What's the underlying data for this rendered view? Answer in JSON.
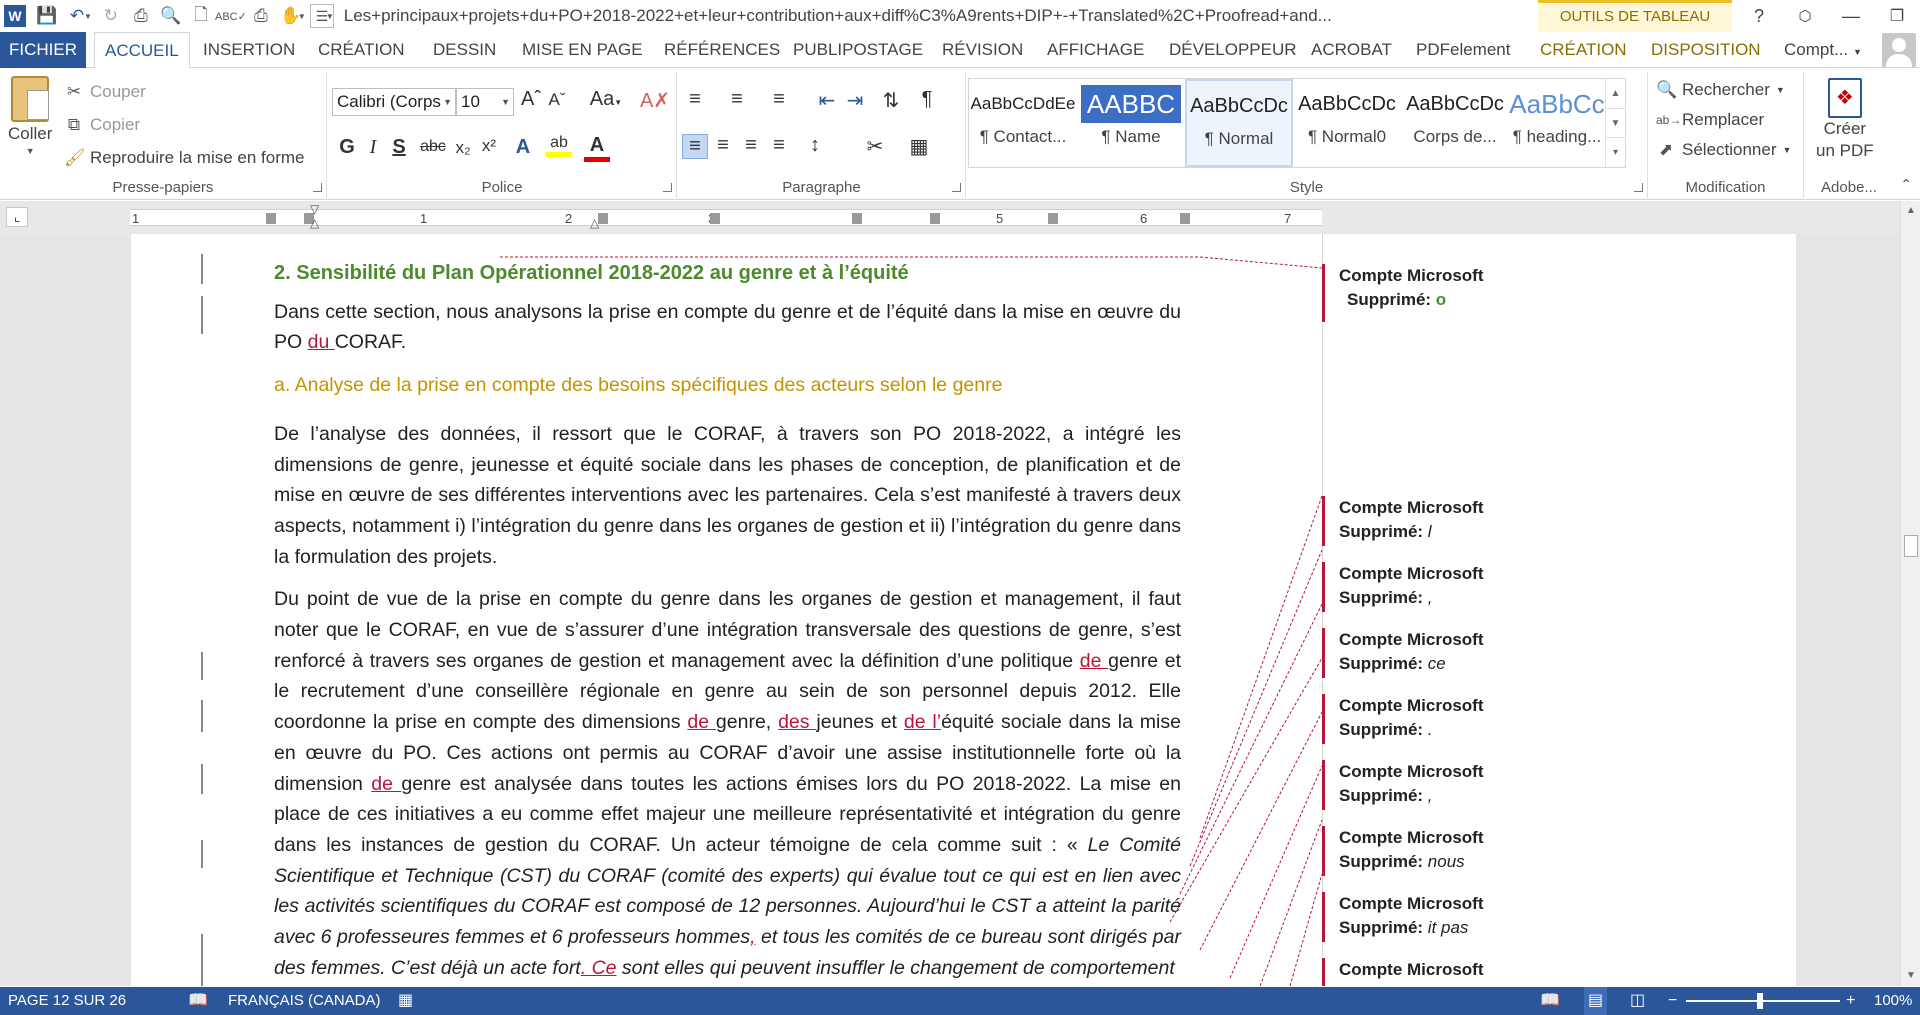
{
  "window": {
    "title": "Les+principaux+projets+du+PO+2018-2022+et+leur+contribution+aux+diff%C3%A9rents+DIP+-+Translated%2C+Proofread+and...",
    "context_tab": "OUTILS DE TABLEAU",
    "help": "?"
  },
  "tabs": {
    "file": "FICHIER",
    "home": "ACCUEIL",
    "insert": "INSERTION",
    "design": "CRÉATION",
    "draw": "DESSIN",
    "layout": "MISE EN PAGE",
    "references": "RÉFÉRENCES",
    "mailings": "PUBLIPOSTAGE",
    "review": "RÉVISION",
    "view": "AFFICHAGE",
    "developer": "DÉVELOPPEUR",
    "acrobat": "ACROBAT",
    "pdfelement": "PDFelement",
    "table_design": "CRÉATION",
    "table_layout": "DISPOSITION",
    "account": "Compt..."
  },
  "ribbon": {
    "clipboard": {
      "label": "Presse-papiers",
      "paste": "Coller",
      "cut": "Couper",
      "copy": "Copier",
      "format_painter": "Reproduire la mise en forme"
    },
    "font": {
      "label": "Police",
      "font_name": "Calibri (Corps",
      "font_size": "10",
      "case_label": "Aa"
    },
    "paragraph": {
      "label": "Paragraphe"
    },
    "styles": {
      "label": "Style",
      "items": [
        {
          "preview": "AaBbCcDdEe",
          "name": "¶ Contact..."
        },
        {
          "preview": "AABBC",
          "name": "¶ Name"
        },
        {
          "preview": "AaBbCcDc",
          "name": "¶ Normal"
        },
        {
          "preview": "AaBbCcDc",
          "name": "¶ Normal0"
        },
        {
          "preview": "AaBbCcDc",
          "name": "Corps de..."
        },
        {
          "preview": "AaBbCc",
          "name": "¶ heading..."
        }
      ]
    },
    "editing": {
      "label": "Modification",
      "find": "Rechercher",
      "replace": "Remplacer",
      "select": "Sélectionner"
    },
    "adobe": {
      "label": "Adobe...",
      "create_pdf_1": "Créer",
      "create_pdf_2": "un PDF"
    }
  },
  "ruler": {
    "numbers": [
      "1",
      "1",
      "2",
      "3",
      "4",
      "5",
      "6",
      "7"
    ]
  },
  "document": {
    "heading2": "2.   Sensibilité du Plan Opérationnel 2018-2022 au genre et à l’équité",
    "intro": {
      "a": "Dans cette section, nous analysons la prise en compte du genre et de l’équité dans la mise en œuvre du PO ",
      "ins": "du ",
      "b": "CORAF."
    },
    "heading3": "a.    Analyse de la prise en compte des besoins spécifiques des acteurs selon le genre",
    "para1": "De l’analyse des données, il ressort que le CORAF, à travers son PO 2018-2022, a intégré les dimensions de genre, jeunesse et équité sociale dans les phases de conception, de planification et de mise en œuvre de ses différentes interventions avec les partenaires. Cela s’est manifesté à travers deux aspects, notamment i) l’intégration du genre dans les organes de gestion et ii) l’intégration du genre dans la formulation des projets.",
    "para2": {
      "s1": "Du point de vue de la prise en compte du genre dans les organes de gestion et management, il faut noter que le CORAF, en vue de s’assurer d’une intégration transversale des questions de genre, s’est renforcé à travers ses organes de gestion et management avec la définition d’une politique ",
      "i1": "de ",
      "s2": "genre et le recrutement d’une conseillère régionale en genre au sein de son personnel depuis 2012. Elle coordonne la prise en compte des dimensions ",
      "i2": "de ",
      "s3": "genre, ",
      "i3": "des ",
      "s4": "jeunes et ",
      "i4": "de l’",
      "s5": "équité sociale dans la mise en œuvre du PO. Ces actions ont permis au CORAF d’avoir une assise institutionnelle forte où la dimension ",
      "i5": "de ",
      "s6": "genre est analysée dans toutes les actions émises lors du PO 2018-2022. La mise en place de ces initiatives a eu comme effet majeur une meilleure représentativité et intégration du genre dans les instances de gestion du CORAF. Un acteur témoigne de cela comme suit : « ",
      "q1": "Le Comité Scientifique et Technique (CST) du CORAF (comité des experts) qui évalue tout ce qui est en lien avec les activités scientifiques du CORAF est composé de 12 personnes. Aujourd’hui le CST a atteint la parité avec 6 professeures femmes et 6 professeurs hommes",
      "i6": ",",
      "q2": " et tous les comités de ce bureau sont dirigés par des femmes. C’est déjà un acte fort",
      "i7": ". Ce",
      "q3": " sont elles qui peuvent insuffler le changement de comportement"
    }
  },
  "comments": [
    {
      "author": "Compte Microsoft",
      "label": "Supprimé:",
      "value": "o"
    },
    {
      "author": "Compte Microsoft",
      "label": "Supprimé:",
      "value": "l"
    },
    {
      "author": "Compte Microsoft",
      "label": "Supprimé:",
      "value": ","
    },
    {
      "author": "Compte Microsoft",
      "label": "Supprimé:",
      "value": "ce"
    },
    {
      "author": "Compte Microsoft",
      "label": "Supprimé:",
      "value": "."
    },
    {
      "author": "Compte Microsoft",
      "label": "Supprimé:",
      "value": ","
    },
    {
      "author": "Compte Microsoft",
      "label": "Supprimé:",
      "value": "nous"
    },
    {
      "author": "Compte Microsoft",
      "label": "Supprimé:",
      "value": "it pas"
    },
    {
      "author": "Compte Microsoft",
      "label": "",
      "value": ""
    }
  ],
  "status": {
    "page": "PAGE 12 SUR 26",
    "language": "FRANÇAIS (CANADA)",
    "zoom": "100%"
  },
  "colors": {
    "accent": "#2b579a",
    "revision": "#b8163a",
    "heading2": "#4d8a2d",
    "heading3": "#c59300"
  }
}
